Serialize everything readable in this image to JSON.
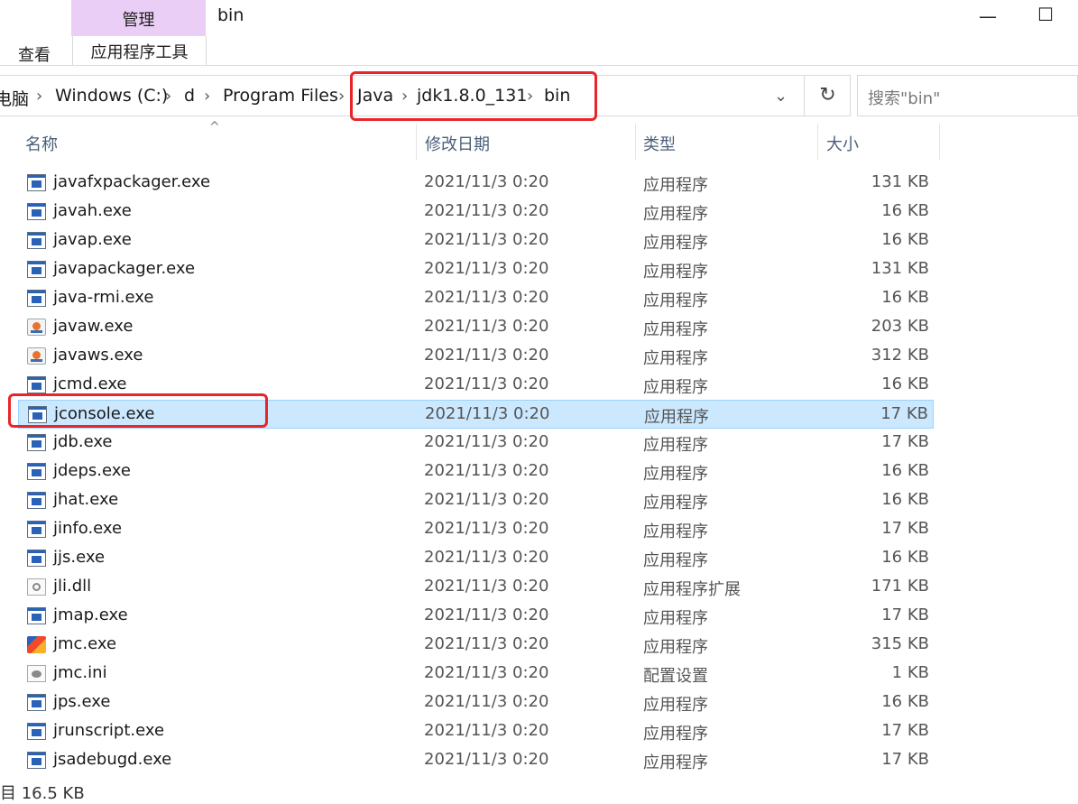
{
  "ribbon": {
    "context_tab": "管理",
    "title": "bin",
    "tab_view": "查看",
    "tab_app_tools": "应用程序工具",
    "window_controls": {
      "minimize": "—",
      "maximize": "☐"
    }
  },
  "address": {
    "crumbs": [
      "电脑",
      "Windows (C:)",
      "d",
      "Program Files",
      "Java",
      "jdk1.8.0_131",
      "bin"
    ],
    "separator": "›",
    "dropdown_glyph": "⌄",
    "refresh_glyph": "↻",
    "search_placeholder": "搜索\"bin\""
  },
  "columns": {
    "name": "名称",
    "date": "修改日期",
    "type": "类型",
    "size": "大小",
    "sort_glyph": "^"
  },
  "files": [
    {
      "name": "javafxpackager.exe",
      "date": "2021/11/3 0:20",
      "type": "应用程序",
      "size": "131 KB",
      "icon": "exe-icon"
    },
    {
      "name": "javah.exe",
      "date": "2021/11/3 0:20",
      "type": "应用程序",
      "size": "16 KB",
      "icon": "exe-icon"
    },
    {
      "name": "javap.exe",
      "date": "2021/11/3 0:20",
      "type": "应用程序",
      "size": "16 KB",
      "icon": "exe-icon"
    },
    {
      "name": "javapackager.exe",
      "date": "2021/11/3 0:20",
      "type": "应用程序",
      "size": "131 KB",
      "icon": "exe-icon"
    },
    {
      "name": "java-rmi.exe",
      "date": "2021/11/3 0:20",
      "type": "应用程序",
      "size": "16 KB",
      "icon": "exe-icon"
    },
    {
      "name": "javaw.exe",
      "date": "2021/11/3 0:20",
      "type": "应用程序",
      "size": "203 KB",
      "icon": "java-icon"
    },
    {
      "name": "javaws.exe",
      "date": "2021/11/3 0:20",
      "type": "应用程序",
      "size": "312 KB",
      "icon": "java-icon"
    },
    {
      "name": "jcmd.exe",
      "date": "2021/11/3 0:20",
      "type": "应用程序",
      "size": "16 KB",
      "icon": "exe-icon"
    },
    {
      "name": "jconsole.exe",
      "date": "2021/11/3 0:20",
      "type": "应用程序",
      "size": "17 KB",
      "icon": "exe-icon",
      "selected": true
    },
    {
      "name": "jdb.exe",
      "date": "2021/11/3 0:20",
      "type": "应用程序",
      "size": "17 KB",
      "icon": "exe-icon"
    },
    {
      "name": "jdeps.exe",
      "date": "2021/11/3 0:20",
      "type": "应用程序",
      "size": "16 KB",
      "icon": "exe-icon"
    },
    {
      "name": "jhat.exe",
      "date": "2021/11/3 0:20",
      "type": "应用程序",
      "size": "16 KB",
      "icon": "exe-icon"
    },
    {
      "name": "jinfo.exe",
      "date": "2021/11/3 0:20",
      "type": "应用程序",
      "size": "17 KB",
      "icon": "exe-icon"
    },
    {
      "name": "jjs.exe",
      "date": "2021/11/3 0:20",
      "type": "应用程序",
      "size": "16 KB",
      "icon": "exe-icon"
    },
    {
      "name": "jli.dll",
      "date": "2021/11/3 0:20",
      "type": "应用程序扩展",
      "size": "171 KB",
      "icon": "dll-icon"
    },
    {
      "name": "jmap.exe",
      "date": "2021/11/3 0:20",
      "type": "应用程序",
      "size": "17 KB",
      "icon": "exe-icon"
    },
    {
      "name": "jmc.exe",
      "date": "2021/11/3 0:20",
      "type": "应用程序",
      "size": "315 KB",
      "icon": "jmc-icon"
    },
    {
      "name": "jmc.ini",
      "date": "2021/11/3 0:20",
      "type": "配置设置",
      "size": "1 KB",
      "icon": "ini-icon"
    },
    {
      "name": "jps.exe",
      "date": "2021/11/3 0:20",
      "type": "应用程序",
      "size": "16 KB",
      "icon": "exe-icon"
    },
    {
      "name": "jrunscript.exe",
      "date": "2021/11/3 0:20",
      "type": "应用程序",
      "size": "17 KB",
      "icon": "exe-icon"
    },
    {
      "name": "jsadebugd.exe",
      "date": "2021/11/3 0:20",
      "type": "应用程序",
      "size": "17 KB",
      "icon": "exe-icon"
    }
  ],
  "status": {
    "selected_size": "目 16.5 KB"
  },
  "colors": {
    "selected_row": "#cce8ff",
    "context_tab": "#ebcef5",
    "annotation": "#e8262a"
  }
}
